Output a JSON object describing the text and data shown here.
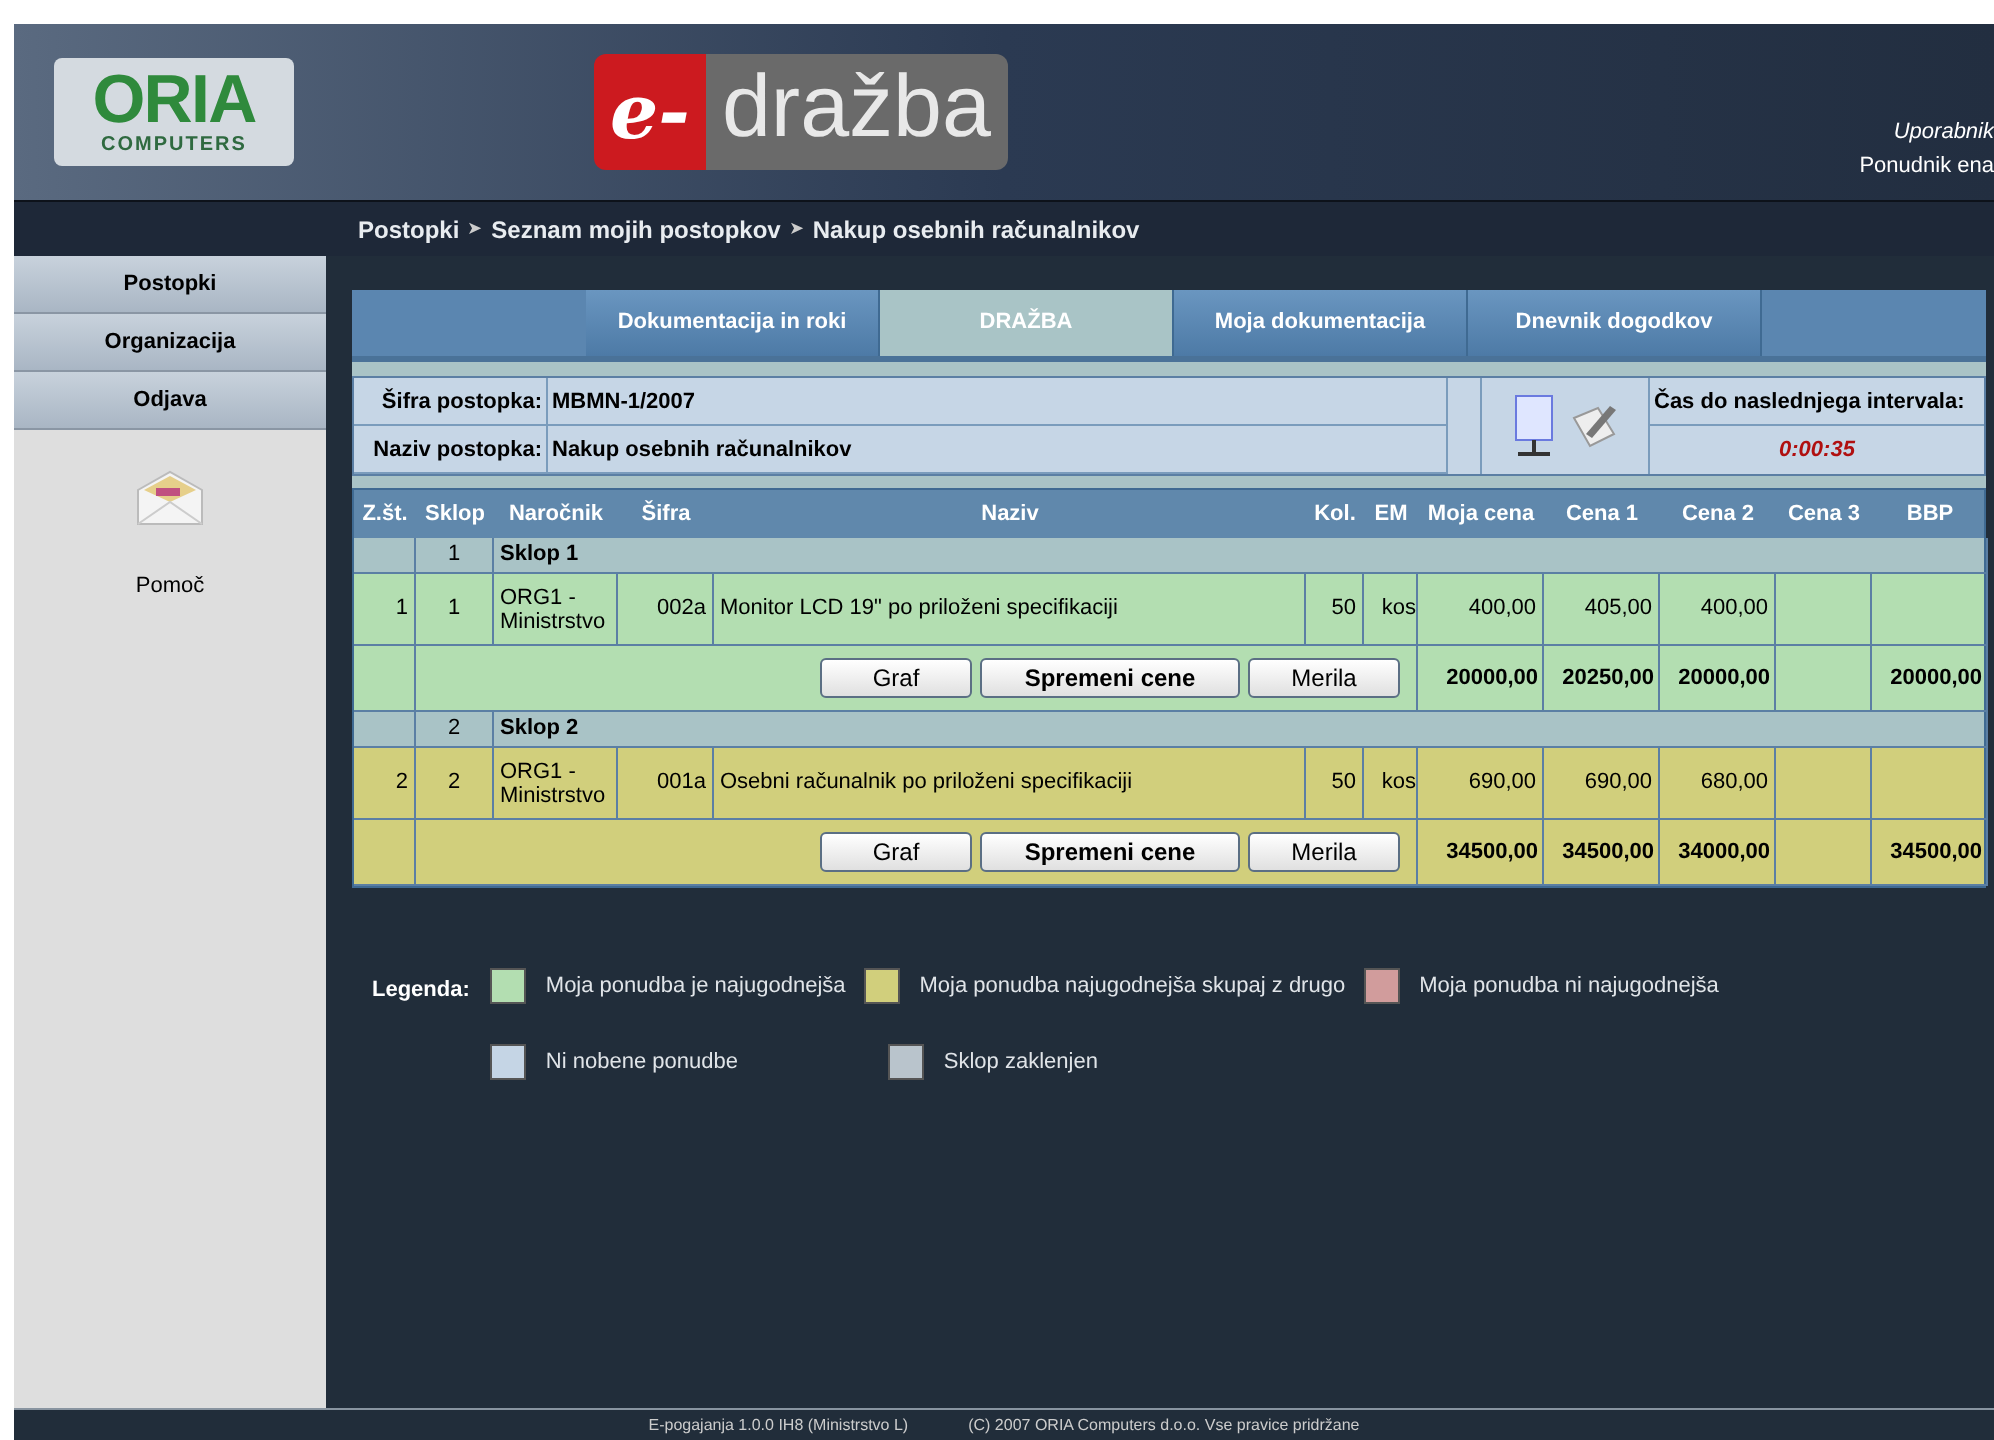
{
  "header": {
    "brand_logo": {
      "name": "ORIA",
      "subtitle": "COMPUTERS"
    },
    "app_logo": {
      "prefix": "e-",
      "name": "dražba"
    },
    "user": {
      "label": "Uporabnik",
      "name": "Ponudnik ena"
    }
  },
  "breadcrumb": [
    "Postopki",
    "Seznam mojih postopkov",
    "Nakup osebnih računalnikov"
  ],
  "breadcrumb_separator": "➤",
  "sidebar": {
    "items": [
      {
        "label": "Postopki"
      },
      {
        "label": "Organizacija"
      },
      {
        "label": "Odjava"
      }
    ],
    "help": {
      "label": "Pomoč"
    }
  },
  "tabs": [
    {
      "label": "Dokumentacija in roki",
      "selected": false
    },
    {
      "label": "DRAŽBA",
      "selected": true
    },
    {
      "label": "Moja dokumentacija",
      "selected": false
    },
    {
      "label": "Dnevnik dogodkov",
      "selected": false
    }
  ],
  "info": {
    "fields": [
      {
        "label": "Šifra postopka:",
        "value": "MBMN-1/2007"
      },
      {
        "label": "Naziv postopka:",
        "value": "Nakup osebnih računalnikov"
      }
    ],
    "timer_label": "Čas do naslednjega intervala:",
    "timer": "0:00:35"
  },
  "table": {
    "columns": [
      "Z.št.",
      "Sklop",
      "Naročnik",
      "Šifra",
      "Naziv",
      "Kol.",
      "EM",
      "Moja cena",
      "Cena 1",
      "Cena 2",
      "Cena 3",
      "BBP"
    ],
    "lots": [
      {
        "number": "1",
        "name": "Sklop 1",
        "color": "#b3deb1",
        "items": [
          {
            "cells": [
              "1",
              "1",
              "ORG1 - Ministrstvo",
              "002a",
              "Monitor LCD 19\" po priloženi specifikaciji",
              "50",
              "kos",
              "400,00",
              "405,00",
              "400,00",
              null,
              null
            ]
          }
        ],
        "buttons": [
          "Graf",
          "Spremeni cene",
          "Merila"
        ],
        "totals": {
          "moja_cena": "20000,00",
          "cena_1": "20250,00",
          "cena_2": "20000,00",
          "bbp": "20000,00"
        }
      },
      {
        "number": "2",
        "name": "Sklop 2",
        "color": "#d1cf7c",
        "items": [
          {
            "cells": [
              "2",
              "2",
              "ORG1 - Ministrstvo",
              "001a",
              "Osebni računalnik po priloženi specifikaciji",
              "50",
              "kos",
              "690,00",
              "690,00",
              "680,00",
              null,
              null
            ]
          }
        ],
        "buttons": [
          "Graf",
          "Spremeni cene",
          "Merila"
        ],
        "totals": {
          "moja_cena": "34500,00",
          "cena_1": "34500,00",
          "cena_2": "34000,00",
          "bbp": "34500,00"
        }
      }
    ]
  },
  "legend": {
    "title": "Legenda:",
    "items": [
      {
        "label": "Moja ponudba je najugodnejša",
        "color": "#b3deb1"
      },
      {
        "label": "Moja ponudba najugodnejša skupaj z drugo",
        "color": "#d1cf7c"
      },
      {
        "label": "Moja ponudba ni najugodnejša",
        "color": "#d19c9c"
      },
      {
        "label": "Ni nobene ponudbe",
        "color": "#c5d5e5"
      },
      {
        "label": "Sklop zaklenjen",
        "color": "#b9c4cc"
      }
    ]
  },
  "footer": [
    "E-pogajanja 1.0.0 IH8 (Ministrstvo L)",
    "(C) 2007 ORIA Computers d.o.o. Vse pravice pridržane"
  ]
}
